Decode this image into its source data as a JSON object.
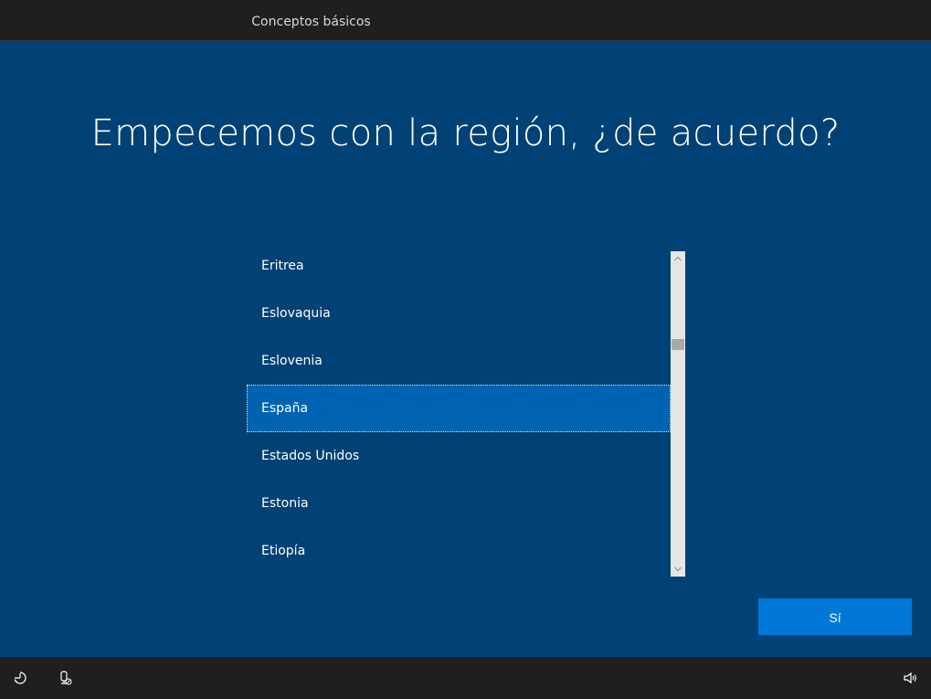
{
  "header": {
    "tab_label": "Conceptos básicos"
  },
  "main": {
    "title": "Empecemos con la región, ¿de acuerdo?",
    "region_list": {
      "items": [
        {
          "label": "Eritrea",
          "selected": false
        },
        {
          "label": "Eslovaquia",
          "selected": false
        },
        {
          "label": "Eslovenia",
          "selected": false
        },
        {
          "label": "España",
          "selected": true
        },
        {
          "label": "Estados Unidos",
          "selected": false
        },
        {
          "label": "Estonia",
          "selected": false
        },
        {
          "label": "Etiopía",
          "selected": false
        }
      ]
    },
    "scrollbar": {
      "up_icon": "chevron-up-icon",
      "down_icon": "chevron-down-icon"
    },
    "yes_button_label": "Sí"
  },
  "footer": {
    "icons": [
      "ease-of-access-icon",
      "microphone-off-icon",
      "volume-icon"
    ]
  },
  "colors": {
    "background": "#004275",
    "selected_item": "#0063b1",
    "primary_button": "#0078d7",
    "bars": "#1f1f1f"
  }
}
